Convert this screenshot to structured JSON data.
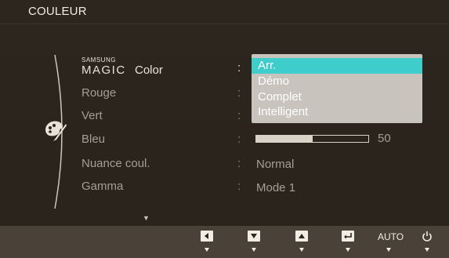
{
  "title": "COULEUR",
  "menu": {
    "magic_small": "SAMSUNG",
    "magic_big": "MAGIC",
    "magic_color": "Color",
    "items": [
      "Rouge",
      "Vert",
      "Bleu",
      "Nuance coul.",
      "Gamma"
    ]
  },
  "dropdown": {
    "options": [
      "Arr.",
      "Démo",
      "Complet",
      "Intelligent"
    ],
    "selected": "Arr."
  },
  "blue_slider": {
    "value": "50",
    "fraction": 0.5
  },
  "values": {
    "nuance": "Normal",
    "gamma": "Mode 1"
  },
  "colon": ":",
  "bottom_bar": {
    "auto_label": "AUTO"
  },
  "colors": {
    "accent": "#3fcdcc",
    "bar": "#4a4239",
    "background": "#2b241c"
  }
}
